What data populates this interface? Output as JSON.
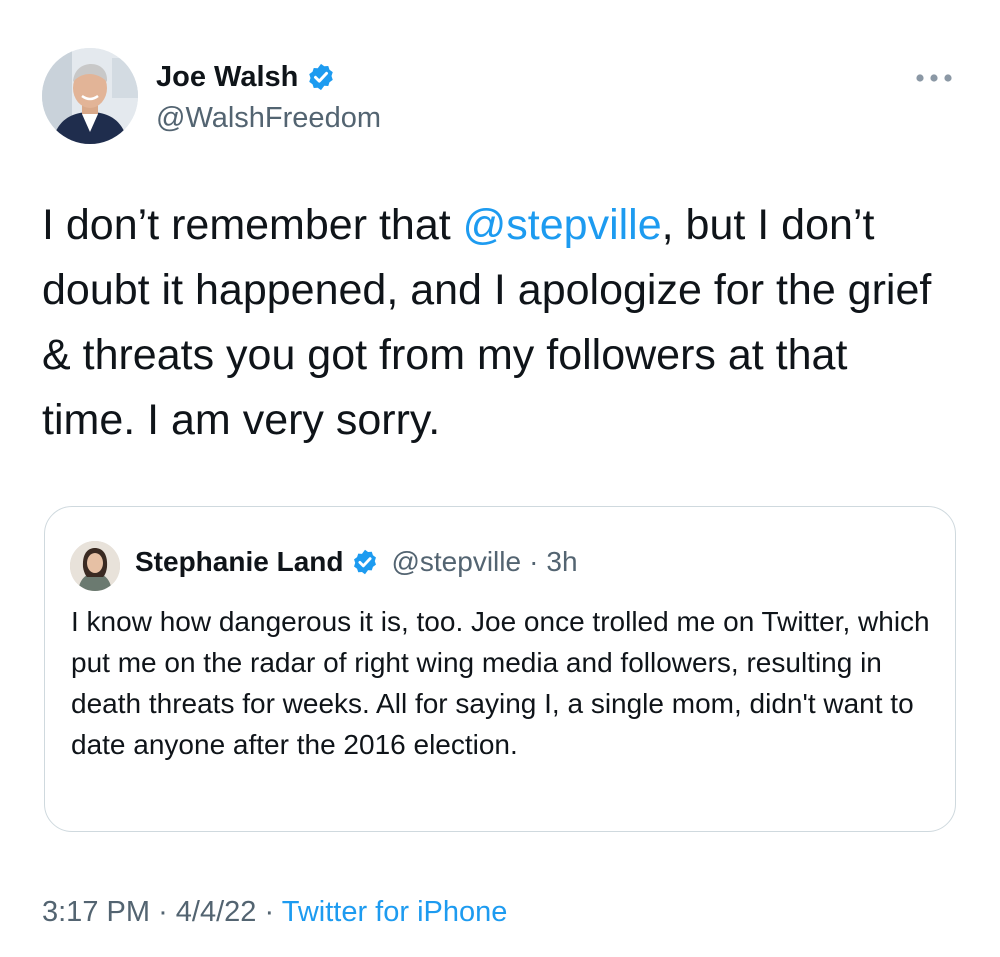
{
  "author": {
    "display_name": "Joe Walsh",
    "handle": "@WalshFreedom",
    "verified": true,
    "avatar_icon": "profile-photo"
  },
  "tweet": {
    "text_before_mention": "I don’t remember that ",
    "mention": "@stepville",
    "text_after_mention": ", but I don’t doubt it happened, and I apologize for the grief & threats you got from my followers at that time. I am very sorry.",
    "time": "3:17 PM",
    "separator": "·",
    "date": "4/4/22",
    "source": "Twitter for iPhone"
  },
  "quoted_tweet": {
    "display_name": "Stephanie Land",
    "handle": "@stepville",
    "separator": "·",
    "age": "3h",
    "verified": true,
    "text": "I know how dangerous it is, too. Joe once trolled me on Twitter, which put me on the radar of right wing media and followers, resulting in death threats for weeks. All for saying I, a single mom, didn't want to date anyone after the 2016 election."
  },
  "colors": {
    "accent": "#1d9bf0",
    "text": "#0f1419",
    "muted": "#536471",
    "border": "#cfd9de"
  }
}
